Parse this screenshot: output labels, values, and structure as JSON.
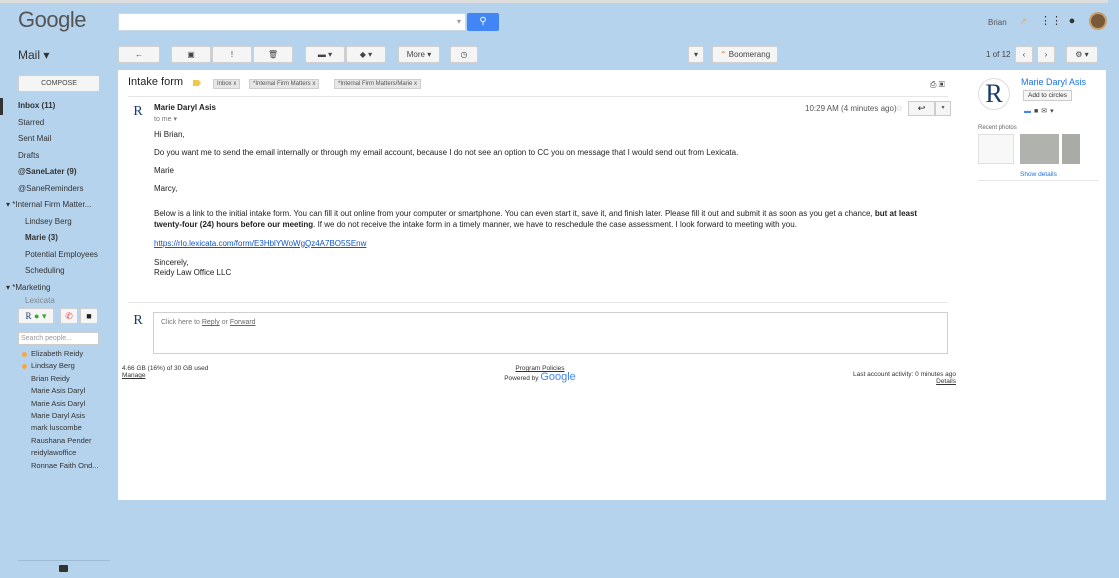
{
  "topbar": {
    "logo": "Google",
    "search_placeholder": "",
    "user_name": "Brian"
  },
  "toolbar": {
    "mail_label": "Mail ▾",
    "more_label": "More ▾",
    "boomerang_label": "Boomerang",
    "pager_text": "1 of 12"
  },
  "nav": {
    "compose": "COMPOSE",
    "items": [
      {
        "label": "Inbox (11)"
      },
      {
        "label": "Starred"
      },
      {
        "label": "Sent Mail"
      },
      {
        "label": "Drafts"
      },
      {
        "label": "@SaneLater (9)"
      },
      {
        "label": "@SaneReminders"
      },
      {
        "label": "▾ *Internal Firm Matter..."
      },
      {
        "label": "Lindsey Berg"
      },
      {
        "label": "Marie (3)"
      },
      {
        "label": "Potential Employees"
      },
      {
        "label": "Scheduling"
      },
      {
        "label": "▾ *Marketing"
      },
      {
        "label": "Lexicata"
      }
    ]
  },
  "chat": {
    "search_placeholder": "Search people...",
    "contacts": [
      {
        "name": "Elizabeth Reidy"
      },
      {
        "name": "Lindsay Berg"
      },
      {
        "name": "Brian Reidy"
      },
      {
        "name": "Marie Asis Daryl"
      },
      {
        "name": "Marie Asis Daryl"
      },
      {
        "name": "Marie Daryl Asis"
      },
      {
        "name": "mark luscombe"
      },
      {
        "name": "Raushana Pender"
      },
      {
        "name": "reidylawoffice"
      },
      {
        "name": "Ronnae Faith Ond..."
      }
    ]
  },
  "email": {
    "subject": "Intake form",
    "labels": [
      "Inbox x",
      "*Internal Firm Matters x",
      "*Internal Firm Matters/Marie x"
    ],
    "sender": "Marie Daryl Asis",
    "to": "to me ▾",
    "time": "10:29 AM (4 minutes ago)",
    "greeting": "Hi Brian,",
    "p1": "Do you want me to send the email internally or through my email account, because I do not see an option to CC you on message that I would send out from Lexicata.",
    "sign1": "Marie",
    "marcy": "Marcy,",
    "p2_a": "Below is a link to the initial intake form. You can fill it out online from your computer or smartphone. You can even start it, save it, and finish later. Please fill it out and submit it as soon as you get a chance,",
    "p2_b": " but at least twenty-four (24) hours before our meeting",
    "p2_c": ". If we do not receive the intake form in a timely manner, we have to reschedule the case assessment.  I look forward to meeting with you.",
    "link": "https://rlo.lexicata.com/form/E3HblYWoWgQz4A7BO5SEnw",
    "closing": "Sincerely,",
    "firm": "Reidy Law Office LLC",
    "reply_prompt": "Click here to ",
    "reply_word": "Reply",
    "or_word": " or ",
    "forward_word": "Forward"
  },
  "footer": {
    "storage": "4.66 GB (16%) of 30 GB used",
    "manage": "Manage",
    "policies": "Program Policies",
    "powered": "Powered by ",
    "powered_logo": "Google",
    "activity": "Last account activity: 0 minutes ago",
    "details": "Details"
  },
  "contact_card": {
    "name": "Marie Daryl Asis",
    "add": "Add to circles",
    "recent": "Recent photos",
    "show_details": "Show details"
  },
  "colors": {
    "background": "#b5d3ed",
    "accent": "#4285f4",
    "link": "#1155cc"
  }
}
